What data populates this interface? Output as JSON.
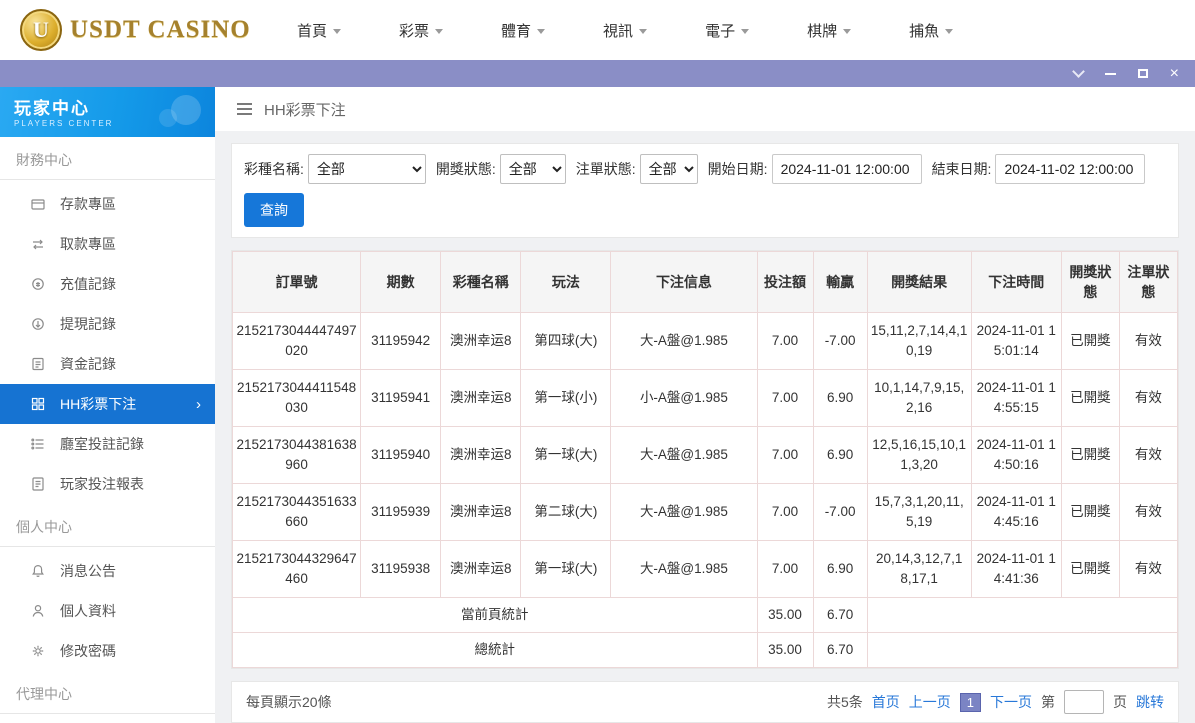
{
  "header": {
    "logo_letter": "U",
    "logo_text": "USDT CASINO",
    "nav": [
      {
        "label": "首頁"
      },
      {
        "label": "彩票"
      },
      {
        "label": "體育"
      },
      {
        "label": "視訊"
      },
      {
        "label": "電子"
      },
      {
        "label": "棋牌"
      },
      {
        "label": "捕魚"
      }
    ]
  },
  "sidebar": {
    "title": "玩家中心",
    "subtitle": "PLAYERS CENTER",
    "sections": [
      {
        "label": "財務中心",
        "items": [
          {
            "label": "存款專區",
            "icon": "deposit-icon"
          },
          {
            "label": "取款專區",
            "icon": "withdraw-icon"
          },
          {
            "label": "充值記錄",
            "icon": "recharge-record-icon"
          },
          {
            "label": "提現記錄",
            "icon": "withdrawal-record-icon"
          },
          {
            "label": "資金記錄",
            "icon": "funds-record-icon"
          },
          {
            "label": "HH彩票下注",
            "icon": "lottery-bet-icon",
            "active": true
          },
          {
            "label": "廳室投註記錄",
            "icon": "hall-bet-record-icon"
          },
          {
            "label": "玩家投注報表",
            "icon": "player-report-icon"
          }
        ]
      },
      {
        "label": "個人中心",
        "items": [
          {
            "label": "消息公告",
            "icon": "announcement-icon"
          },
          {
            "label": "個人資料",
            "icon": "profile-icon"
          },
          {
            "label": "修改密碼",
            "icon": "password-icon"
          }
        ]
      },
      {
        "label": "代理中心",
        "items": []
      }
    ]
  },
  "toolbar": {
    "title": "HH彩票下注"
  },
  "filters": {
    "lottery_label": "彩種名稱:",
    "lottery_value": "全部",
    "draw_status_label": "開獎狀態:",
    "draw_status_value": "全部",
    "order_status_label": "注單狀態:",
    "order_status_value": "全部",
    "start_label": "開始日期:",
    "start_value": "2024-11-01 12:00:00",
    "end_label": "結束日期:",
    "end_value": "2024-11-02 12:00:00",
    "search_label": "查詢"
  },
  "table": {
    "headers": [
      "訂單號",
      "期數",
      "彩種名稱",
      "玩法",
      "下注信息",
      "投注額",
      "輸贏",
      "開獎結果",
      "下注時間",
      "開獎狀態",
      "注單狀態"
    ],
    "rows": [
      [
        "2152173044447497020",
        "31195942",
        "澳洲幸运8",
        "第四球(大)",
        "大-A盤@1.985",
        "7.00",
        "-7.00",
        "15,11,2,7,14,4,10,19",
        "2024-11-01 15:01:14",
        "已開獎",
        "有效"
      ],
      [
        "2152173044411548030",
        "31195941",
        "澳洲幸运8",
        "第一球(小)",
        "小-A盤@1.985",
        "7.00",
        "6.90",
        "10,1,14,7,9,15,2,16",
        "2024-11-01 14:55:15",
        "已開獎",
        "有效"
      ],
      [
        "2152173044381638960",
        "31195940",
        "澳洲幸运8",
        "第一球(大)",
        "大-A盤@1.985",
        "7.00",
        "6.90",
        "12,5,16,15,10,11,3,20",
        "2024-11-01 14:50:16",
        "已開獎",
        "有效"
      ],
      [
        "2152173044351633660",
        "31195939",
        "澳洲幸运8",
        "第二球(大)",
        "大-A盤@1.985",
        "7.00",
        "-7.00",
        "15,7,3,1,20,11,5,19",
        "2024-11-01 14:45:16",
        "已開獎",
        "有效"
      ],
      [
        "2152173044329647460",
        "31195938",
        "澳洲幸运8",
        "第一球(大)",
        "大-A盤@1.985",
        "7.00",
        "6.90",
        "20,14,3,12,7,18,17,1",
        "2024-11-01 14:41:36",
        "已開獎",
        "有效"
      ]
    ],
    "summary": [
      {
        "label": "當前頁統計",
        "bet": "35.00",
        "winloss": "6.70"
      },
      {
        "label": "總統計",
        "bet": "35.00",
        "winloss": "6.70"
      }
    ]
  },
  "pager": {
    "page_size_text": "每頁顯示20條",
    "total_text": "共5条",
    "first": "首页",
    "prev": "上一页",
    "current": "1",
    "next": "下一页",
    "jump_prefix": "第",
    "jump_suffix": "页",
    "jump_action": "跳转"
  }
}
